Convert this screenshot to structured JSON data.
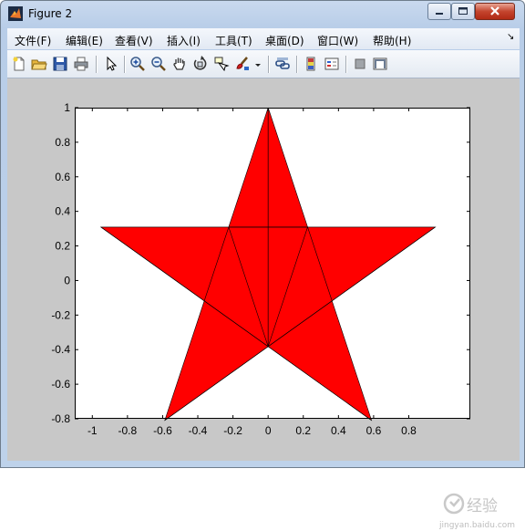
{
  "window": {
    "title": "Figure 2",
    "icon": "matlab-logo-icon"
  },
  "menu": [
    {
      "label": "文件(F)",
      "key": "file"
    },
    {
      "label": "编辑(E)",
      "key": "edit"
    },
    {
      "label": "查看(V)",
      "key": "view"
    },
    {
      "label": "插入(I)",
      "key": "insert"
    },
    {
      "label": "工具(T)",
      "key": "tools"
    },
    {
      "label": "桌面(D)",
      "key": "desktop"
    },
    {
      "label": "窗口(W)",
      "key": "window"
    },
    {
      "label": "帮助(H)",
      "key": "help"
    }
  ],
  "menu_corner": "↘",
  "toolbar": [
    "new-figure-icon",
    "open-file-icon",
    "save-icon",
    "print-icon",
    "select-arrow-icon",
    "zoom-in-icon",
    "zoom-out-icon",
    "pan-hand-icon",
    "rotate-3d-icon",
    "data-cursor-icon",
    "brush-icon",
    "brush-dropdown-icon",
    "link-plot-icon",
    "colorbar-icon",
    "legend-icon",
    "hide-plot-tools-icon",
    "show-plot-tools-icon"
  ],
  "watermark": {
    "logo_text": "经验",
    "site": "jingyan.baidu.com"
  },
  "chart_data": {
    "type": "area",
    "title": "",
    "xlabel": "",
    "ylabel": "",
    "xlim": [
      -1.1,
      1.15
    ],
    "ylim": [
      -0.8,
      1.0
    ],
    "xticks": [
      -1,
      -0.8,
      -0.6,
      -0.4,
      -0.2,
      0,
      0.2,
      0.4,
      0.6,
      0.8
    ],
    "yticks": [
      -0.8,
      -0.6,
      -0.4,
      -0.2,
      0,
      0.2,
      0.4,
      0.6,
      0.8,
      1
    ],
    "grid": false,
    "fill_color": "#ff0000",
    "edge_color": "#000000",
    "background": "#ffffff",
    "series": [
      {
        "values": [
          [
            0,
            1
          ],
          [
            -0.2245,
            0.309
          ],
          [
            0,
            -0.382
          ]
        ]
      },
      {
        "values": [
          [
            0,
            1
          ],
          [
            0.2245,
            0.309
          ],
          [
            0,
            -0.382
          ]
        ]
      },
      {
        "values": [
          [
            -0.951,
            0.309
          ],
          [
            -0.3633,
            -0.118
          ],
          [
            0.5878,
            -0.809
          ]
        ]
      },
      {
        "values": [
          [
            -0.951,
            0.309
          ],
          [
            0.2245,
            0.309
          ],
          [
            0.5878,
            -0.809
          ]
        ]
      },
      {
        "values": [
          [
            0.951,
            0.309
          ],
          [
            0.3633,
            -0.118
          ],
          [
            -0.5878,
            -0.809
          ]
        ]
      },
      {
        "values": [
          [
            0.951,
            0.309
          ],
          [
            -0.2245,
            0.309
          ],
          [
            -0.5878,
            -0.809
          ]
        ]
      }
    ]
  }
}
